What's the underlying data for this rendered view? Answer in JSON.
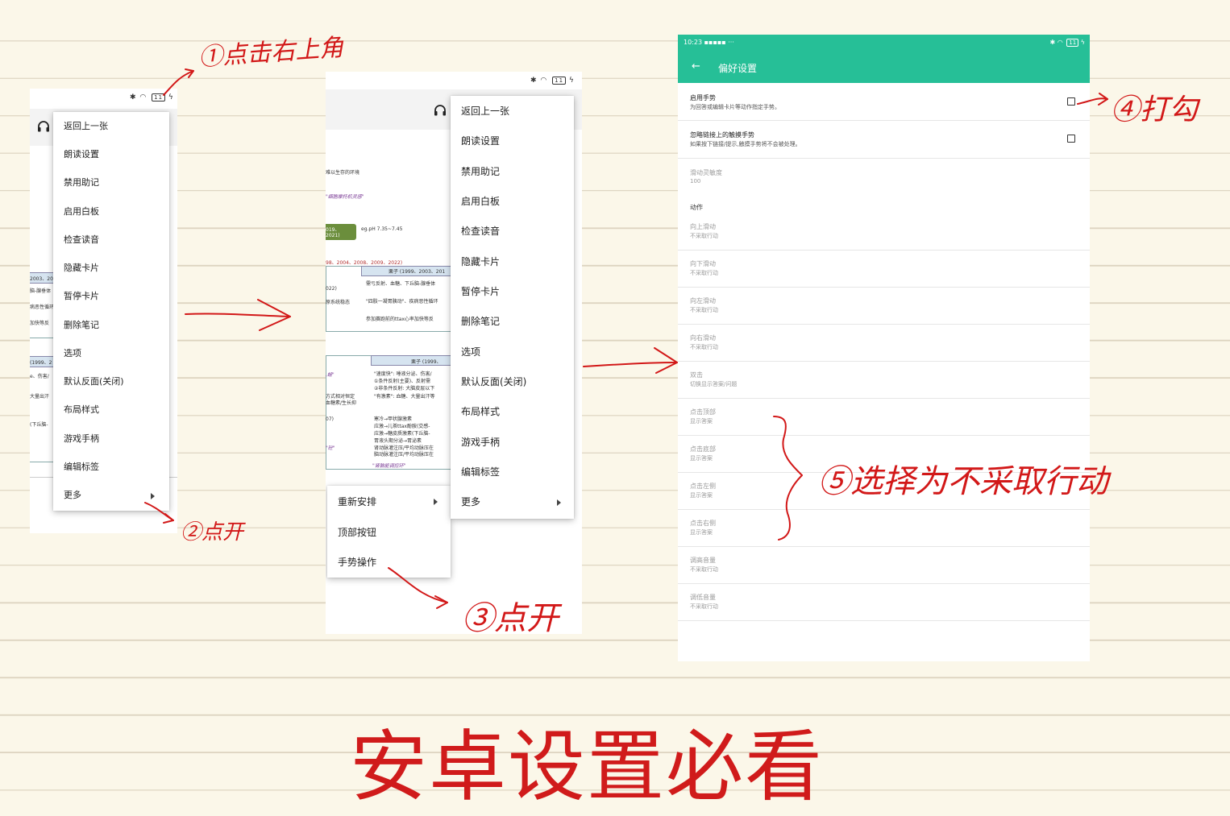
{
  "status_bar": {
    "battery": "11",
    "time": "10:23"
  },
  "menu_main": {
    "items": [
      "返回上一张",
      "朗读设置",
      "禁用助记",
      "启用白板",
      "检查读音",
      "隐藏卡片",
      "暂停卡片",
      "删除笔记",
      "选项",
      "默认反面(关闭)",
      "布局样式",
      "游戏手柄",
      "编辑标签",
      "更多"
    ]
  },
  "submenu_more": {
    "items": [
      "重新安排",
      "顶部按钮",
      "手势操作"
    ]
  },
  "card_bg": {
    "line1": "难以生存的环境",
    "line2": "\"细胞摩托机灵感\"",
    "green_box": "019、2021)",
    "ph": "eg.pH 7.35~7.45",
    "years": "98、2004、2008、2009、2022)",
    "table_head": "栗子 (1999、2003、201",
    "table_head2": "栗子 (1999、",
    "r1": "需亏反射、血糖、下丘脑-腺垂体",
    "r2": "\"四肢一凝胃胰动\"、疾病恶性循环",
    "r3": "参加赛跑前的ttax心率加快等反",
    "r4": "\"速度快\": 唾液分泌、伤害/",
    "r5": "①条件反射(主要)、反射需",
    "r6": "②非条件反射: 大脑皮层以下",
    "r7": "\"有激素\": 血糖、大量出汗等",
    "r8": "寒冷→甲状腺激素",
    "r9": "应激→儿茶ttax酚胺(交感-",
    "r10": "应激→糖皮质激素(下丘脑-",
    "r11": "胃液头期分泌→胃泌素",
    "r12": "肾动脉灌注压/平均动脉压在",
    "r13": "脑动脉灌注压/平均动脉压在",
    "r14": "\"肾脑能调控环\"",
    "left1": "2003、201",
    "left2": "脑-腺垂体",
    "left3": "病恶性循环",
    "left4": "加快等反",
    "left5": "(1999、2",
    "left6": "e、伤害/",
    "left7": "(下丘脑-",
    "left8": "大量出汗",
    "mid1": "022)",
    "mid2": "原系统稳态",
    "mid3": "方式相对恒定",
    "mid4": "血糖素/生长抑",
    "mid5": "07)",
    "mid6": ",蛙\"",
    "mid7": "\"砼\""
  },
  "settings": {
    "title": "偏好设置",
    "back": "←",
    "rows": [
      {
        "title": "启用手势",
        "sub": "为回答或编辑卡片等动作指定手势。",
        "checkbox": true,
        "disabled": false
      },
      {
        "title": "忽略链接上的触摸手势",
        "sub": "如果按下链接/提示,触摸手势将不会被处理。",
        "checkbox": true,
        "disabled": false
      },
      {
        "title": "滑动灵敏度",
        "sub": "100",
        "checkbox": false,
        "disabled": true
      }
    ],
    "category": "动作",
    "actions": [
      {
        "title": "向上滑动",
        "sub": "不采取行动"
      },
      {
        "title": "向下滑动",
        "sub": "不采取行动"
      },
      {
        "title": "向左滑动",
        "sub": "不采取行动"
      },
      {
        "title": "向右滑动",
        "sub": "不采取行动"
      },
      {
        "title": "双击",
        "sub": "切换显示答案/问题"
      },
      {
        "title": "点击顶部",
        "sub": "显示答案"
      },
      {
        "title": "点击底部",
        "sub": "显示答案"
      },
      {
        "title": "点击左侧",
        "sub": "显示答案"
      },
      {
        "title": "点击右侧",
        "sub": "显示答案"
      },
      {
        "title": "调高音量",
        "sub": "不采取行动"
      },
      {
        "title": "调低音量",
        "sub": "不采取行动"
      }
    ]
  },
  "annotations": {
    "step1": "①点击右上角",
    "step2": "②点开",
    "step3": "③点开",
    "step4": "④打勾",
    "step5": "⑤选择为不采取行动"
  },
  "title": "安卓设置必看",
  "colors": {
    "annotation": "#d21818",
    "appbar": "#26bf97",
    "title": "#d01b1b"
  }
}
